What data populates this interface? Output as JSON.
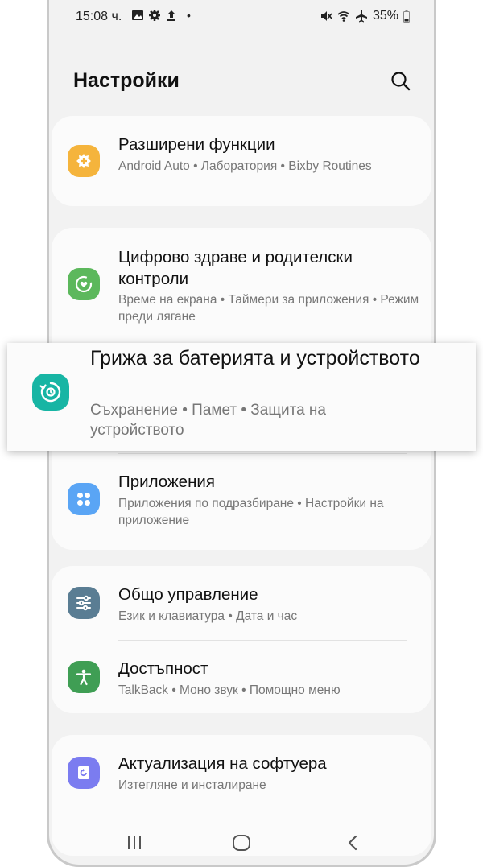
{
  "status_bar": {
    "time": "15:08 ч.",
    "battery": "35%",
    "dot": "•",
    "icons": [
      "image-icon",
      "gear-icon",
      "upload-icon",
      "mute-icon",
      "wifi-icon",
      "airplane-icon",
      "battery-icon"
    ]
  },
  "header": {
    "title": "Настройки"
  },
  "items": [
    {
      "title": "Разширени функции",
      "subtitle": "Android Auto  •  Лаборатория  •  Bixby Routines",
      "icon": "advanced-features-icon",
      "color": "#f5b43c"
    },
    {
      "title": "Цифрово здраве и родителски контроли",
      "subtitle": "Време на екрана  •  Таймери за приложения  •  Режим преди лягане",
      "icon": "digital-wellbeing-icon",
      "color": "#5cb85c"
    },
    {
      "title": "Грижа за батерията и устройството",
      "subtitle": "Съхранение  •  Памет  •  Защита на устройството",
      "icon": "device-care-icon",
      "color": "#17b5a4"
    },
    {
      "title": "Приложения",
      "subtitle": "Приложения по подразбиране  •  Настройки на приложение",
      "icon": "apps-icon",
      "color": "#5aa5f5"
    },
    {
      "title": "Общо управление",
      "subtitle": "Език и клавиатура  •  Дата и час",
      "icon": "general-management-icon",
      "color": "#5a7d93"
    },
    {
      "title": "Достъпност",
      "subtitle": "TalkBack  •  Моно звук  •  Помощно меню",
      "icon": "accessibility-icon",
      "color": "#3f9e54"
    },
    {
      "title": "Актуализация на софтуера",
      "subtitle": "Изтегляне и инсталиране",
      "icon": "software-update-icon",
      "color": "#7b7cf0"
    }
  ],
  "navbar": {
    "icons": [
      "recents-icon",
      "home-icon",
      "back-icon"
    ]
  }
}
